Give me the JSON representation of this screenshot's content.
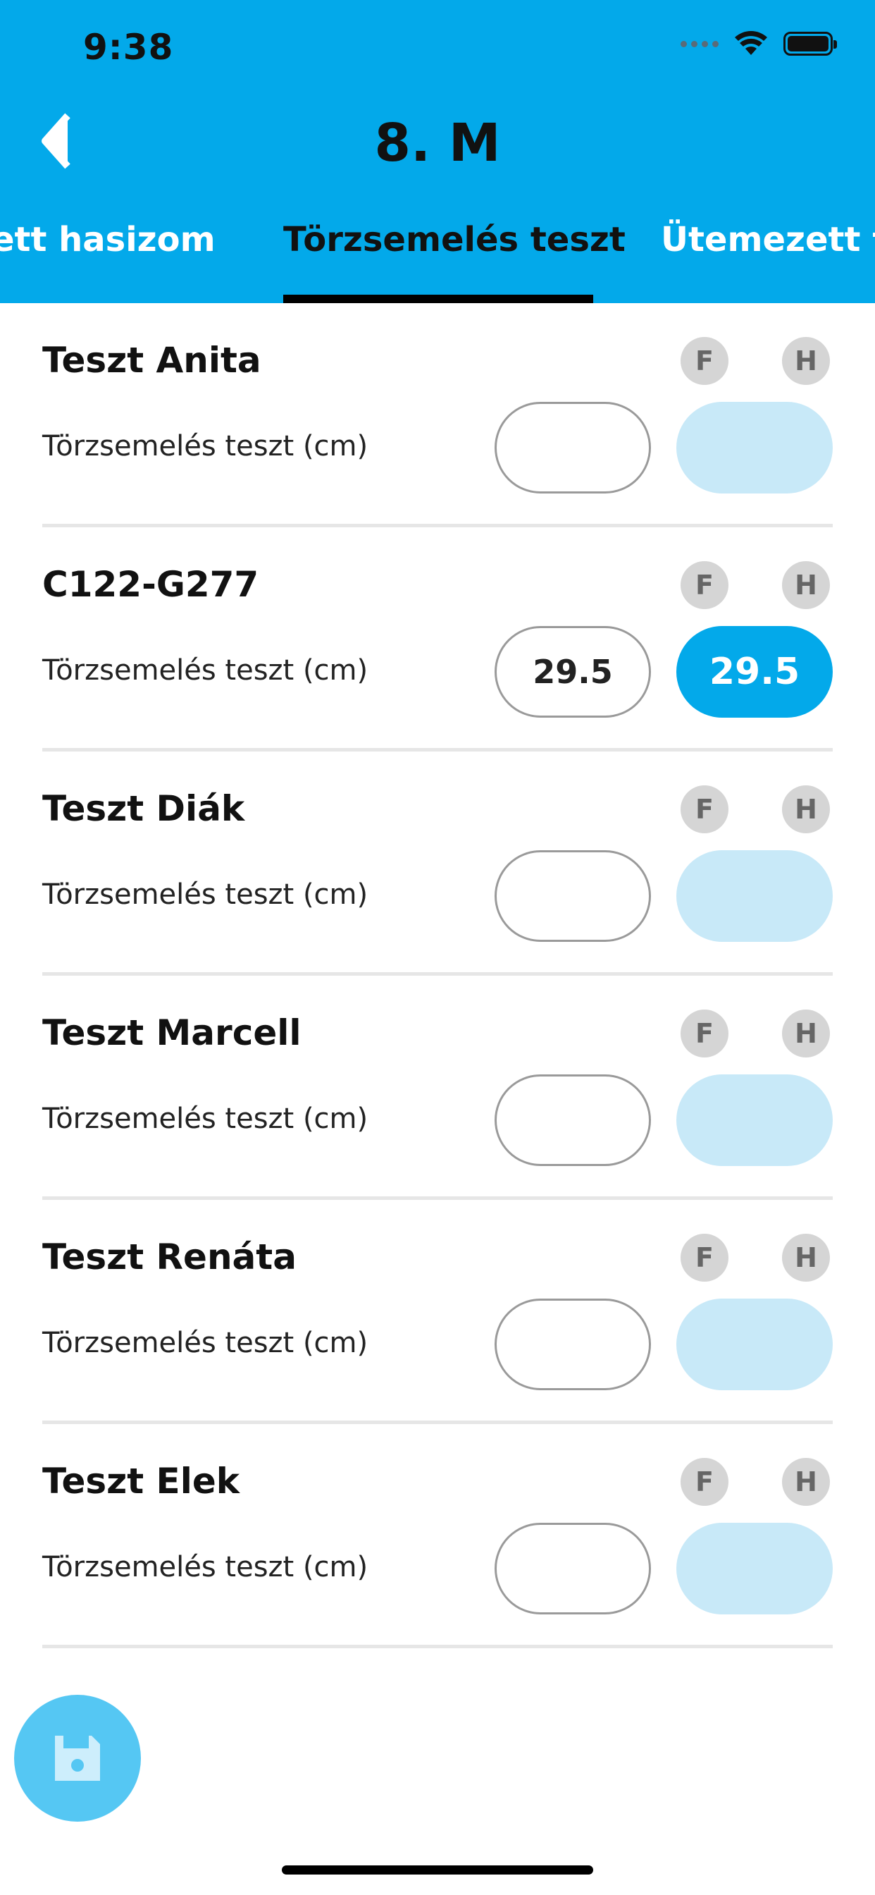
{
  "status_bar": {
    "time": "9:38"
  },
  "header": {
    "title": "8. M",
    "tabs": [
      {
        "label": "Ütemezett hasizom",
        "display": "zett hasizom"
      },
      {
        "label": "Törzsemelés teszt",
        "active": true
      },
      {
        "label": "Ütemezett fe"
      }
    ]
  },
  "badges": {
    "f": "F",
    "h": "H"
  },
  "rows": [
    {
      "name": "Teszt Anita",
      "label": "Törzsemelés teszt (cm)",
      "input": "",
      "result": ""
    },
    {
      "name": "C122-G277",
      "label": "Törzsemelés teszt (cm)",
      "input": "29.5",
      "result": "29.5"
    },
    {
      "name": "Teszt Diák",
      "label": "Törzsemelés teszt (cm)",
      "input": "",
      "result": ""
    },
    {
      "name": "Teszt Marcell",
      "label": "Törzsemelés teszt (cm)",
      "input": "",
      "result": ""
    },
    {
      "name": "Teszt Renáta",
      "label": "Törzsemelés teszt (cm)",
      "input": "",
      "result": ""
    },
    {
      "name": "Teszt Elek",
      "label": "Törzsemelés teszt (cm)",
      "input": "",
      "result": ""
    }
  ],
  "icons": {
    "back": "chevron-left-icon",
    "save": "floppy-disk-icon"
  },
  "colors": {
    "header": "#03a9ea",
    "result_filled": "#03a9ea",
    "result_empty": "#c8e9f8",
    "fab": "#55c7f3"
  }
}
